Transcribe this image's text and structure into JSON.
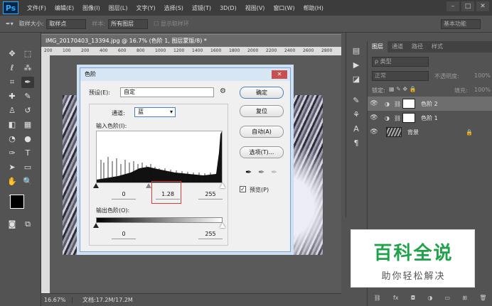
{
  "app": {
    "logo": "Ps"
  },
  "menu": [
    "文件(F)",
    "编辑(E)",
    "图像(I)",
    "图层(L)",
    "文字(Y)",
    "选择(S)",
    "滤镜(T)",
    "3D(D)",
    "视图(V)",
    "窗口(W)",
    "帮助(H)"
  ],
  "options": {
    "sample_size_label": "取样大小:",
    "sample_size_value": "取样点",
    "sample_label": "样本:",
    "sample_value": "所有图层",
    "show_ring": "显示取样环",
    "workspace": "基本功能"
  },
  "document": {
    "tab_title": "IMG_20170403_13394.jpg @ 16.7% (色阶 1, 图层蒙版/8) *",
    "ruler_ticks": [
      "200",
      "100",
      "200",
      "400",
      "600",
      "800",
      "1000",
      "1200",
      "1400",
      "1600",
      "1800",
      "2000",
      "2200",
      "2400",
      "2600",
      "2800"
    ],
    "zoom": "16.67%",
    "doc_info": "文档:17.2M/17.2M"
  },
  "layers_panel": {
    "tabs": [
      "图层",
      "通道",
      "路径",
      "样式"
    ],
    "filter_placeholder": "ρ 类型",
    "blend_mode": "正常",
    "opacity_label": "不透明度:",
    "opacity_value": "100%",
    "lock_label": "锁定:",
    "fill_label": "填充:",
    "fill_value": "100%",
    "layers": [
      {
        "name": "色阶 2",
        "selected": true
      },
      {
        "name": "色阶 1",
        "selected": false
      },
      {
        "name": "背景",
        "selected": false
      }
    ]
  },
  "dialog": {
    "title": "色阶",
    "preset_label": "预设(E):",
    "preset_value": "自定",
    "channel_label": "通道:",
    "channel_value": "蓝",
    "input_label": "输入色阶(I):",
    "input_values": [
      "0",
      "1.28",
      "255"
    ],
    "output_label": "输出色阶(O):",
    "output_values": [
      "0",
      "255"
    ],
    "buttons": {
      "ok": "确定",
      "reset": "复位",
      "auto": "自动(A)",
      "options": "选项(T)..."
    },
    "preview_label": "预览(P)",
    "preview_checked": true
  },
  "watermark": {
    "title": "百科全说",
    "subtitle": "助你轻松解决"
  },
  "colors": {
    "watermark_green": "#1fa34a",
    "highlight_red": "#e23a3a",
    "ps_blue": "#31a8ff"
  }
}
